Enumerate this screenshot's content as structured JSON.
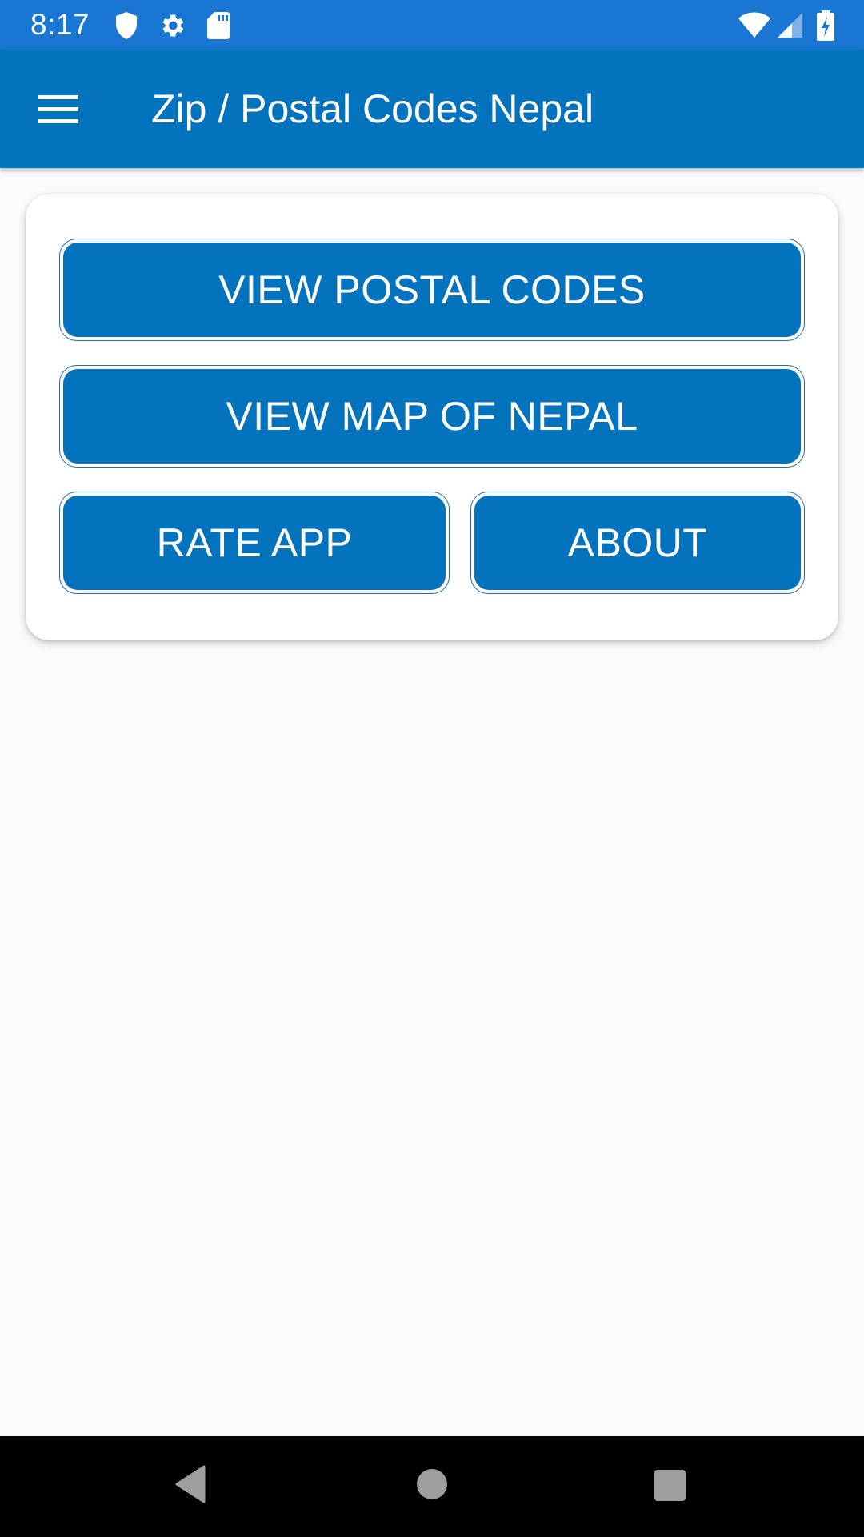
{
  "status_bar": {
    "time": "8:17",
    "left_icons": [
      "shield-icon",
      "gear-icon",
      "sd-card-icon"
    ],
    "right_icons": [
      "wifi-icon",
      "signal-icon",
      "battery-charging-icon"
    ]
  },
  "app_bar": {
    "menu_icon": "hamburger-menu-icon",
    "title": "Zip / Postal Codes Nepal"
  },
  "main": {
    "buttons": [
      {
        "label": "VIEW POSTAL CODES"
      },
      {
        "label": "VIEW MAP OF NEPAL"
      },
      {
        "label": "RATE APP"
      },
      {
        "label": "ABOUT"
      }
    ]
  },
  "nav_bar": {
    "buttons": [
      "back-icon",
      "home-icon",
      "recents-icon"
    ]
  },
  "colors": {
    "status_bar": "#1976d2",
    "app_bar": "#0373bd",
    "button": "#0373bd",
    "background": "#fafafa"
  }
}
